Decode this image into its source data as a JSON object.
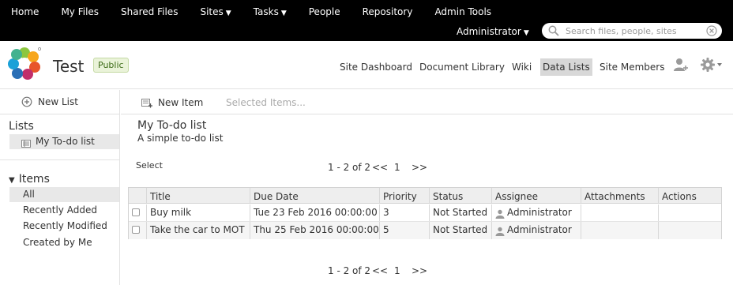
{
  "top_nav": {
    "home": "Home",
    "my_files": "My Files",
    "shared_files": "Shared Files",
    "sites": "Sites",
    "tasks": "Tasks",
    "people": "People",
    "repository": "Repository",
    "admin_tools": "Admin Tools"
  },
  "user_menu": {
    "name": "Administrator"
  },
  "search": {
    "placeholder": "Search files, people, sites",
    "value": ""
  },
  "site": {
    "title": "Test",
    "visibility": "Public",
    "nav": {
      "dashboard": "Site Dashboard",
      "doclib": "Document Library",
      "wiki": "Wiki",
      "data_lists": "Data Lists",
      "members": "Site Members"
    }
  },
  "left_panel": {
    "new_list": "New List",
    "lists_heading": "Lists",
    "lists": [
      "My To-do list"
    ],
    "items_heading": "Items",
    "filters": [
      "All",
      "Recently Added",
      "Recently Modified",
      "Created by Me"
    ]
  },
  "toolbar": {
    "new_item": "New Item",
    "selected_items": "Selected Items..."
  },
  "list": {
    "title": "My To-do list",
    "description": "A simple to-do list"
  },
  "select_label": "Select",
  "pager": {
    "range": "1 - 2 of 2",
    "prev": "<<",
    "page": "1",
    "next": ">>"
  },
  "table": {
    "columns": [
      "Title",
      "Due Date",
      "Priority",
      "Status",
      "Assignee",
      "Attachments",
      "Actions"
    ],
    "rows": [
      {
        "title": "Buy milk",
        "due": "Tue 23 Feb 2016 00:00:00",
        "priority": "3",
        "status": "Not Started",
        "assignee": "Administrator"
      },
      {
        "title": "Take the car to MOT",
        "due": "Thu 25 Feb 2016 00:00:00",
        "priority": "5",
        "status": "Not Started",
        "assignee": "Administrator"
      }
    ]
  },
  "colors": {
    "header_bg": "#000000",
    "badge_bg": "#eaf3d9",
    "badge_text": "#3d6b17",
    "active_nav_bg": "#d8d8d8"
  },
  "icons": [
    "search-icon",
    "clear-search-icon",
    "alfresco-logo-icon",
    "add-user-icon",
    "gear-icon",
    "plus-circle-icon",
    "list-icon",
    "new-item-icon",
    "user-icon"
  ]
}
